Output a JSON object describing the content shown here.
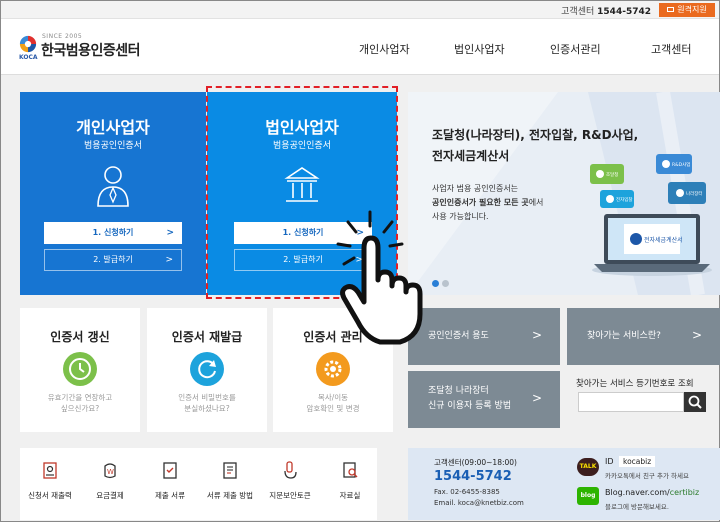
{
  "topbar": {
    "customer_center_label": "고객센터",
    "customer_center_phone": "1544-5742",
    "remote_support": "원격지원"
  },
  "header": {
    "logo_since": "SINCE 2005",
    "logo_abbr": "KOCA",
    "logo_name": "한국범용인증센터",
    "nav": [
      "개인사업자",
      "법인사업자",
      "인증서관리",
      "고객센터"
    ]
  },
  "cards": [
    {
      "title": "개인사업자",
      "subtitle": "범용공인인증서",
      "apply": "1. 신청하기",
      "issue": "2. 발급하기",
      "icon": "person-icon"
    },
    {
      "title": "법인사업자",
      "subtitle": "범용공인인증서",
      "apply": "1. 신청하기",
      "issue": "2. 발급하기",
      "icon": "building-icon"
    }
  ],
  "arrow": ">",
  "banner": {
    "line1": "조달청(나라장터), 전자입찰, R&D사업,",
    "line2": "전자세금계산서",
    "desc1": "사업자 범용 공인인증서는",
    "desc2_bold": "공인인증서가 필요한 모든 곳",
    "desc2_rest": "에서",
    "desc3": "사용 가능합니다.",
    "screen_label": "전자세금계산서",
    "badges": [
      "R&D사업",
      "나라장터",
      "전자입찰",
      "조달청"
    ]
  },
  "services": [
    {
      "title": "인증서 갱신",
      "desc1": "유효기간을 연장하고",
      "desc2": "싶으신가요?",
      "icon": "clock-icon",
      "color": "#7cc04a"
    },
    {
      "title": "인증서 재발급",
      "desc1": "인증서 비밀번호를",
      "desc2": "분실하셨나요?",
      "icon": "refresh-icon",
      "color": "#1da3dc"
    },
    {
      "title": "인증서 관리",
      "desc1": "복사/이동",
      "desc2": "암호확인 및 변경",
      "icon": "gear-icon",
      "color": "#f39a1e"
    }
  ],
  "links": {
    "usage": "공인인증서 용도",
    "find_service": "찾아가는 서비스란?",
    "register1": "조달청 나라장터",
    "register2": "신규 이용자 등록 방법",
    "search_label": "찾아가는 서비스 등기번호로 조회"
  },
  "quick_links": [
    {
      "label": "신청서 재출력",
      "icon": "print-icon"
    },
    {
      "label": "요금결제",
      "icon": "won-icon"
    },
    {
      "label": "제출 서류",
      "icon": "clipboard-icon"
    },
    {
      "label": "서류 제출 방법",
      "icon": "document-icon"
    },
    {
      "label": "지문보안토큰",
      "icon": "token-icon"
    },
    {
      "label": "자료실",
      "icon": "archive-icon"
    }
  ],
  "contact": {
    "title": "고객센터(09:00~18:00)",
    "phone": "1544-5742",
    "fax": "Fax. 02-6455-8385",
    "email": "Email. koca@knetbiz.com",
    "talk_icon_text": "TALK",
    "id_label": "ID",
    "id_value": "kocabiz",
    "talk_desc": "카카오톡에서 친구 추가 하세요",
    "blog_icon_text": "blog",
    "blog_url_prefix": "Blog.naver.com/",
    "blog_url_suffix": "certibiz",
    "blog_desc": "블로그에 방문해보세요."
  },
  "colors": {
    "individual_card": "#1775d2",
    "corporate_card": "#0a8be4",
    "highlight_dash": "#e21f26",
    "remote_button": "#ea6a1f",
    "gray_button": "#7d8a94"
  }
}
